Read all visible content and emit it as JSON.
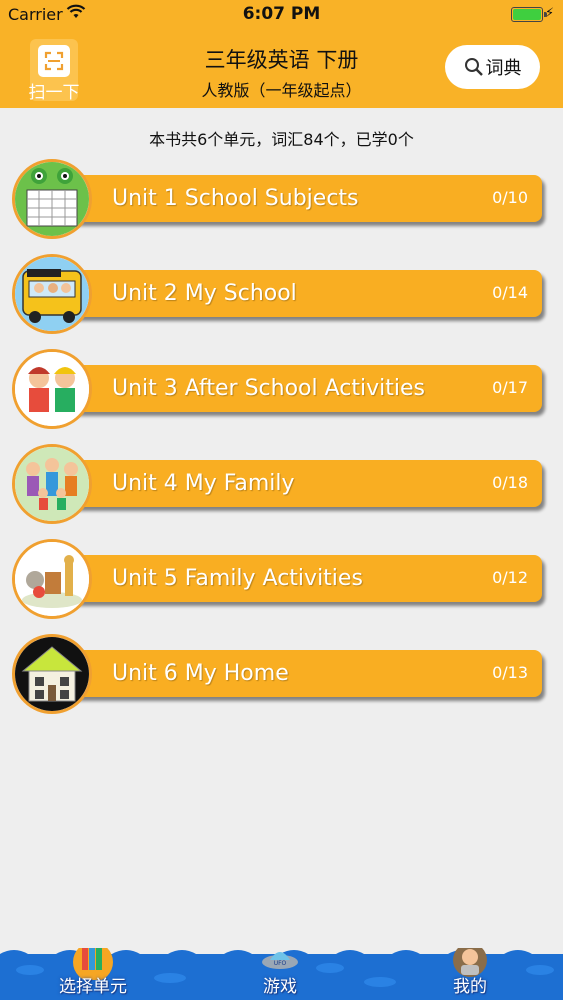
{
  "status_bar": {
    "carrier": "Carrier",
    "time": "6:07 PM"
  },
  "header": {
    "scan_label": "扫一下",
    "title": "三年级英语 下册",
    "subtitle": "人教版（一年级起点）",
    "dict_label": "词典",
    "bg_color": "#f9b227"
  },
  "summary": "本书共6个单元，词汇84个，已学0个",
  "units": [
    {
      "title": "Unit 1 School Subjects",
      "progress": "0/10",
      "icon": "timetable-frog-icon"
    },
    {
      "title": "Unit 2 My School",
      "progress": "0/14",
      "icon": "school-bus-icon"
    },
    {
      "title": "Unit 3 After School Activities",
      "progress": "0/17",
      "icon": "kids-activities-icon"
    },
    {
      "title": "Unit 4 My Family",
      "progress": "0/18",
      "icon": "family-icon"
    },
    {
      "title": "Unit 5 Family Activities",
      "progress": "0/12",
      "icon": "family-activities-icon"
    },
    {
      "title": "Unit 6 My Home",
      "progress": "0/13",
      "icon": "house-icon"
    }
  ],
  "tabs": [
    {
      "label": "选择单元",
      "icon": "books-icon"
    },
    {
      "label": "游戏",
      "icon": "ufo-icon"
    },
    {
      "label": "我的",
      "icon": "profile-icon"
    }
  ],
  "colors": {
    "accent": "#f9ae22",
    "background": "#eeeeee",
    "tabbar": "#1d6fd2"
  }
}
